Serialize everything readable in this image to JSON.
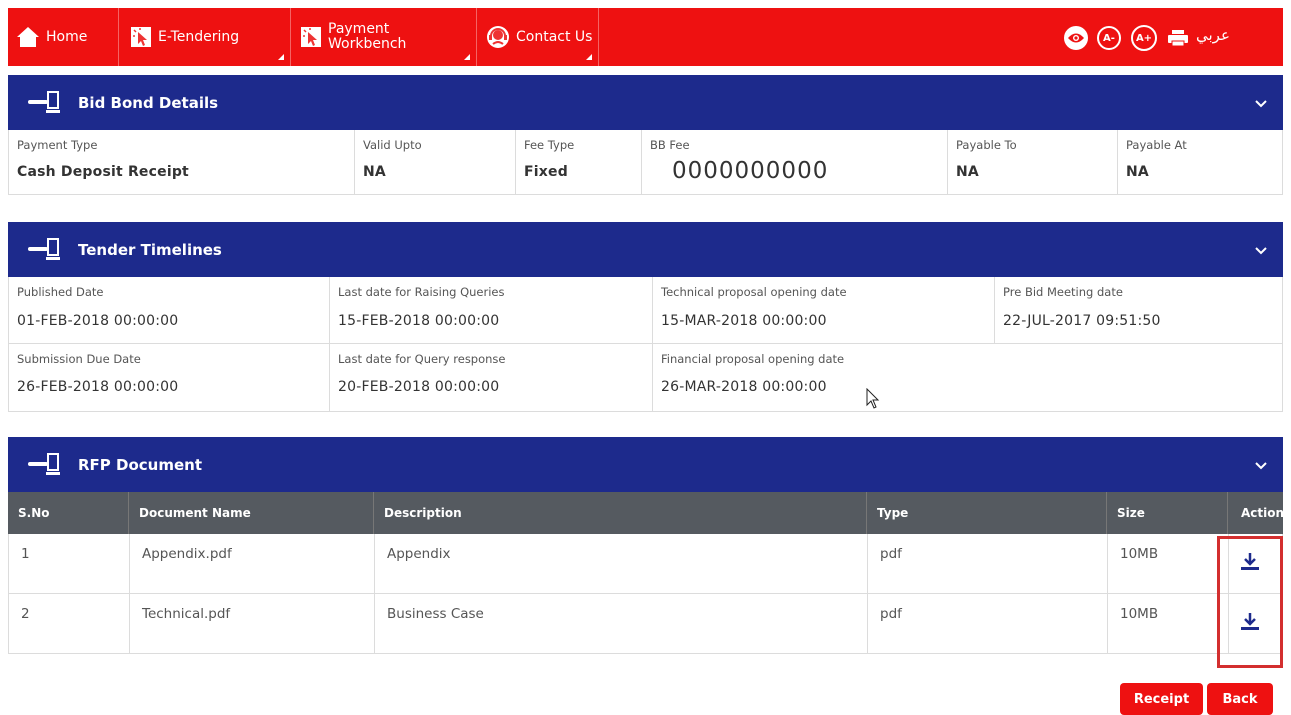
{
  "nav": {
    "home": "Home",
    "etendering": "E-Tendering",
    "payment_line1": "Payment",
    "payment_line2": "Workbench",
    "contact": "Contact Us",
    "arabic": "عربي"
  },
  "bid_bond": {
    "title": "Bid Bond Details",
    "fields": [
      {
        "label": "Payment Type",
        "value": "Cash Deposit Receipt"
      },
      {
        "label": "Valid Upto",
        "value": "NA"
      },
      {
        "label": "Fee Type",
        "value": "Fixed"
      },
      {
        "label": "BB Fee",
        "value": "0000000000"
      },
      {
        "label": "Payable To",
        "value": "NA"
      },
      {
        "label": "Payable At",
        "value": "NA"
      }
    ]
  },
  "timelines": {
    "title": "Tender Timelines",
    "fields": [
      {
        "label": "Published Date",
        "value": "01-FEB-2018 00:00:00"
      },
      {
        "label": "Last date for Raising Queries",
        "value": "15-FEB-2018 00:00:00"
      },
      {
        "label": "Technical proposal opening date",
        "value": "15-MAR-2018 00:00:00"
      },
      {
        "label": "Pre Bid Meeting date",
        "value": "22-JUL-2017 09:51:50"
      },
      {
        "label": "Submission Due Date",
        "value": "26-FEB-2018 00:00:00"
      },
      {
        "label": "Last date for Query response",
        "value": "20-FEB-2018 00:00:00"
      },
      {
        "label": "Financial proposal opening date",
        "value": "26-MAR-2018 00:00:00"
      }
    ]
  },
  "rfp": {
    "title": "RFP Document",
    "columns": [
      "S.No",
      "Document Name",
      "Description",
      "Type",
      "Size",
      "Action"
    ],
    "rows": [
      {
        "sno": "1",
        "name": "Appendix.pdf",
        "desc": "Appendix",
        "type": "pdf",
        "size": "10MB"
      },
      {
        "sno": "2",
        "name": "Technical.pdf",
        "desc": "Business Case",
        "type": "pdf",
        "size": "10MB"
      }
    ]
  },
  "buttons": {
    "receipt": "Receipt",
    "back": "Back"
  },
  "colors": {
    "nav_red": "#ee1111",
    "panel_blue": "#1d2a8c",
    "table_header": "#555a60",
    "highlight": "#d32f2f"
  },
  "icons": {
    "home": "home-icon",
    "etendering": "cursor-click-icon",
    "payment": "cursor-click-icon",
    "contact": "headset-icon",
    "eye": "eye-icon",
    "font_down": "font-decrease-icon",
    "font_up": "font-increase-icon",
    "print": "printer-icon",
    "gavel": "gavel-icon",
    "chevron": "chevron-down-icon",
    "download": "download-icon"
  }
}
